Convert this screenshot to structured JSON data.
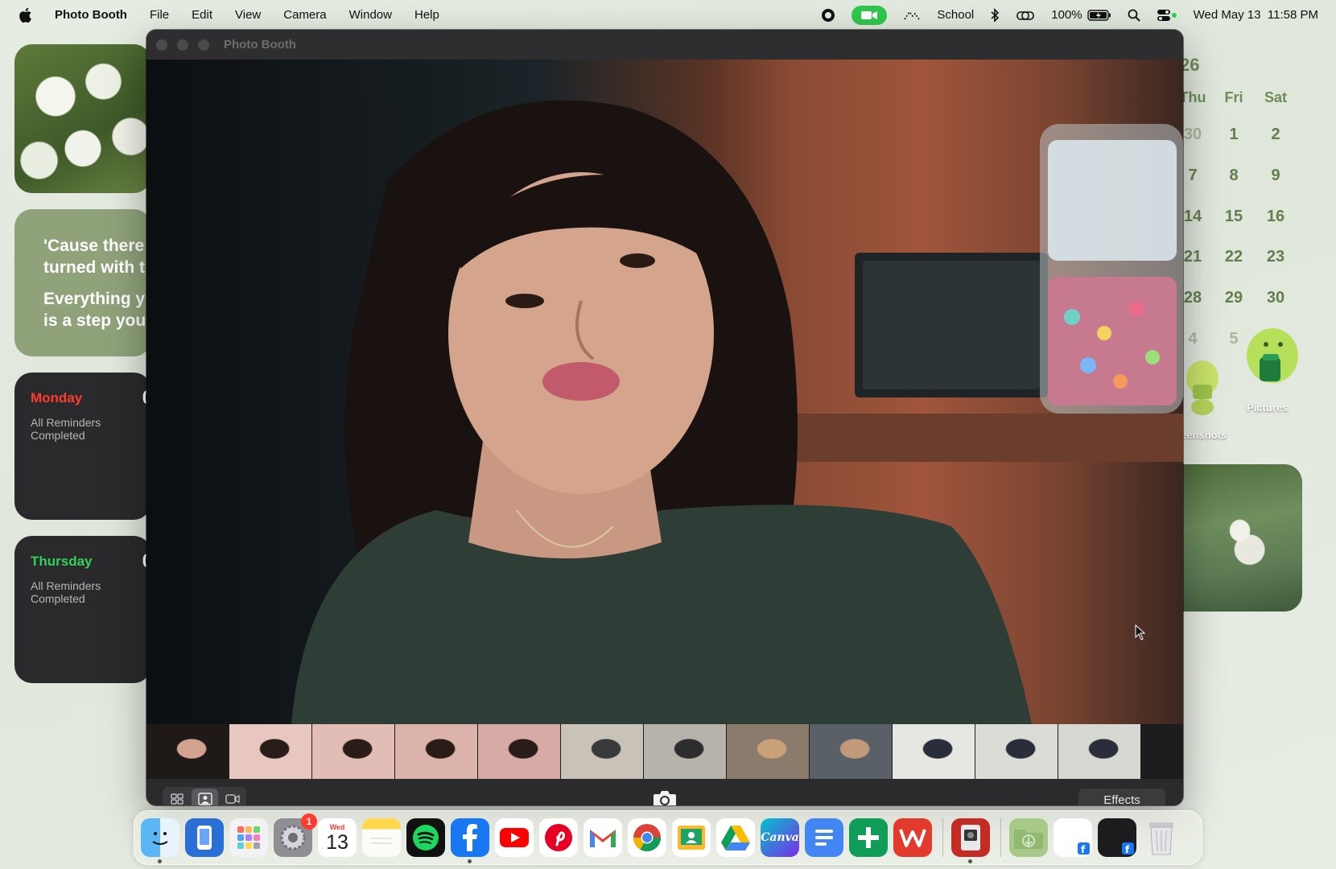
{
  "menubar": {
    "app_name": "Photo Booth",
    "menus": [
      "File",
      "Edit",
      "View",
      "Camera",
      "Window",
      "Help"
    ],
    "focus_label": "School",
    "battery": "100%",
    "datetime": "Wed May 13  11:58 PM"
  },
  "widgets": {
    "quote_lines": [
      "'Cause there",
      "turned with t",
      "Everything y",
      "is a step you t"
    ],
    "reminders": [
      {
        "day": "Monday",
        "count": "0",
        "status": "All Reminders Completed",
        "color": "#ff3b30"
      },
      {
        "day": "Thursday",
        "count": "0",
        "status": "All Reminders Completed",
        "color": "#30d158"
      }
    ]
  },
  "calendar": {
    "year_fragment": "26",
    "headers": [
      "Thu",
      "Fri",
      "Sat"
    ],
    "rows": [
      [
        "30",
        "1",
        "2"
      ],
      [
        "7",
        "8",
        "9"
      ],
      [
        "14",
        "15",
        "16"
      ],
      [
        "21",
        "22",
        "23"
      ],
      [
        "28",
        "29",
        "30"
      ],
      [
        "4",
        "5",
        "6"
      ]
    ]
  },
  "desktop": {
    "folder_left_label": "eenshots",
    "folder_right_label": "Pictures"
  },
  "photo_booth": {
    "window_title": "Photo Booth",
    "effects_label": "Effects",
    "thumbnail_count": 12
  },
  "dock": {
    "apps": [
      "Finder",
      "Apple Configurator",
      "Launchpad",
      "System Settings",
      "Calendar",
      "Notes",
      "Spotify",
      "Facebook",
      "YouTube",
      "Pinterest",
      "Gmail",
      "Chrome",
      "Google Classroom",
      "Google Drive",
      "Canva",
      "Google Docs",
      "Google Sheets",
      "WPS Office",
      "Photo Booth",
      "Downloads",
      "Facebook Doc",
      "Facebook Dark",
      "Trash"
    ],
    "settings_badge": "1",
    "calendar_month": "Wed",
    "calendar_day": "13"
  },
  "colors": {
    "facetime_green": "#2fc84b",
    "monday_red": "#ff3b30",
    "thursday_green": "#30d158",
    "calendar_green": "#6f8d58"
  }
}
